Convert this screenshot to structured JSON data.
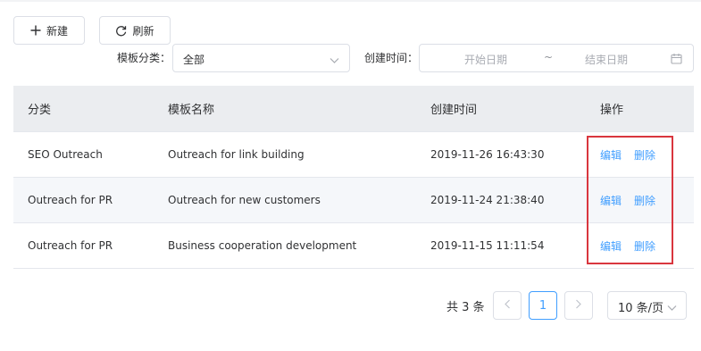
{
  "toolbar": {
    "new_label": "新建",
    "refresh_label": "刷新"
  },
  "filters": {
    "category_label": "模板分类：",
    "category_value": "全部",
    "date_label": "创建时间：",
    "start_placeholder": "开始日期",
    "separator": "~",
    "end_placeholder": "结束日期"
  },
  "table": {
    "headers": [
      "分类",
      "模板名称",
      "创建时间",
      "操作"
    ],
    "rows": [
      {
        "category": "SEO Outreach",
        "name": "Outreach for link building",
        "created": "2019-11-26 16:43:30",
        "edit": "编辑",
        "delete": "删除"
      },
      {
        "category": "Outreach for PR",
        "name": "Outreach for new customers",
        "created": "2019-11-24 21:38:40",
        "edit": "编辑",
        "delete": "删除"
      },
      {
        "category": "Outreach for PR",
        "name": "Business cooperation development",
        "created": "2019-11-15 11:11:54",
        "edit": "编辑",
        "delete": "删除"
      }
    ]
  },
  "pagination": {
    "total": "共 3 条",
    "current_page": "1",
    "page_size": "10 条/页"
  },
  "colors": {
    "accent": "#409eff",
    "highlight": "#d9363e"
  },
  "icons": {
    "new": "plus-icon",
    "refresh": "refresh-icon",
    "select": "chevron-down-icon",
    "calendar": "calendar-icon",
    "prev": "chevron-left-icon",
    "next": "chevron-right-icon"
  }
}
